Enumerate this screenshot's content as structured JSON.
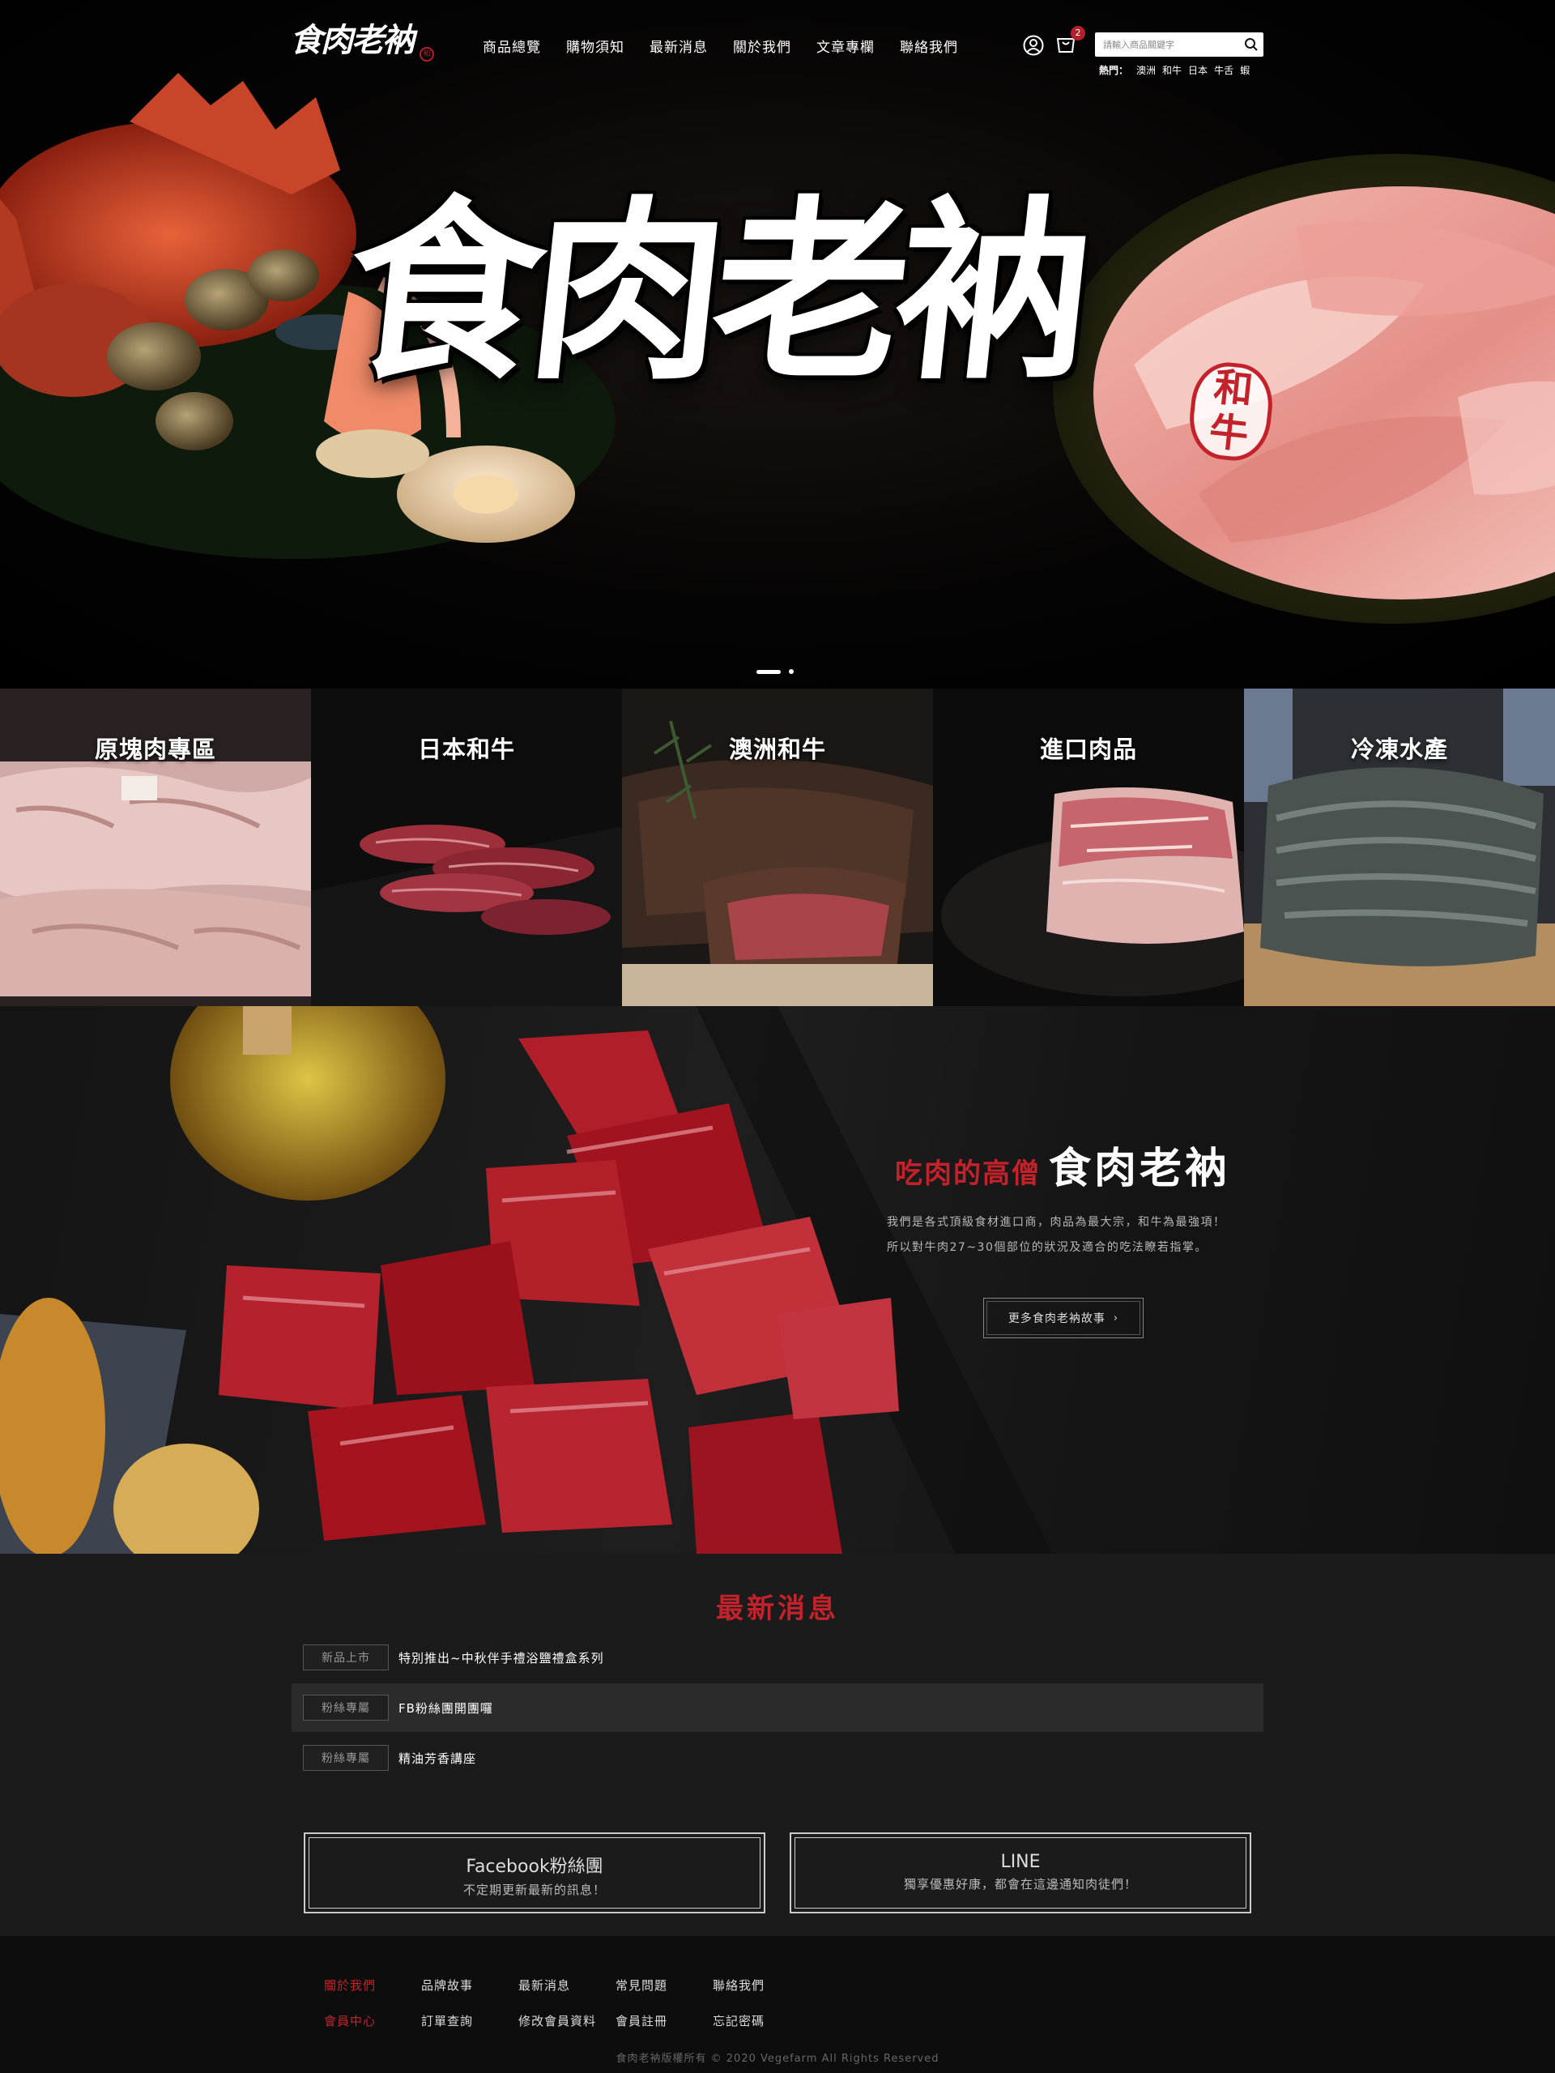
{
  "header": {
    "logo_text": "食肉老衲",
    "logo_seal": "和",
    "nav": [
      "商品總覽",
      "購物須知",
      "最新消息",
      "關於我們",
      "文章專欄",
      "聯絡我們"
    ],
    "cart_count": "2",
    "search_placeholder": "請輸入商品關鍵字",
    "hot_label": "熱門：",
    "hot_tags": [
      "澳洲",
      "和牛",
      "日本",
      "牛舌",
      "蝦"
    ]
  },
  "hero": {
    "title": "食肉老衲",
    "seal": "和牛",
    "slides": 2,
    "active_slide": 1
  },
  "categories": [
    "原塊肉專區",
    "日本和牛",
    "澳洲和牛",
    "進口肉品",
    "冷凍水產"
  ],
  "about": {
    "title_red": "吃肉的高僧",
    "title_white": "食肉老衲",
    "text_line1": "我們是各式頂級食材進口商，肉品為最大宗，和牛為最強項！",
    "text_line2": "所以對牛肉27~30個部位的狀況及適合的吃法瞭若指掌。",
    "button": "更多食肉老衲故事",
    "button_chevron": "›"
  },
  "news": {
    "title": "最新消息",
    "items": [
      {
        "tag": "新品上市",
        "text": "特別推出~中秋伴手禮浴鹽禮盒系列"
      },
      {
        "tag": "粉絲專屬",
        "text": "FB粉絲團開團囉"
      },
      {
        "tag": "粉絲專屬",
        "text": "精油芳香講座"
      }
    ],
    "facebook_title": "Facebook粉絲團",
    "facebook_sub": "不定期更新最新的訊息！",
    "line_title": "LINE",
    "line_sub": "獨享優惠好康，都會在這邊通知肉徒們！"
  },
  "footer": {
    "row1": [
      "關於我們",
      "品牌故事",
      "最新消息",
      "常見問題",
      "聯絡我們"
    ],
    "row2": [
      "會員中心",
      "訂單查詢",
      "修改會員資料",
      "會員註冊",
      "忘記密碼"
    ],
    "copyright": "食肉老衲版權所有 © 2020 Vegefarm All Rights Reserved"
  },
  "colors": {
    "accent_red": "#c4222b",
    "background": "#000000",
    "news_bg": "#1b1b1b"
  }
}
